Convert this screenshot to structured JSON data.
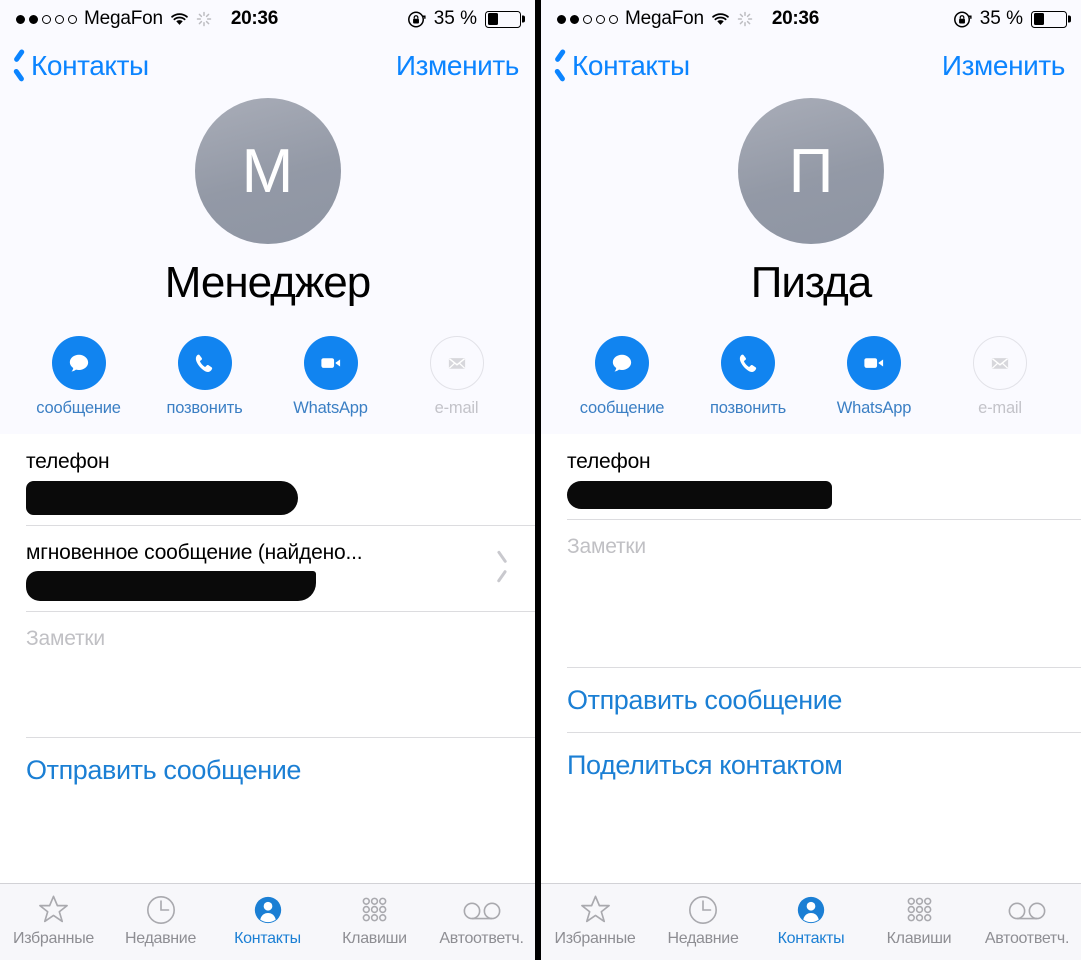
{
  "status_bar": {
    "signal_dots_filled": 2,
    "signal_dots_total": 5,
    "carrier": "MegaFon",
    "wifi_icon": "wifi-icon",
    "activity_icon": "activity-spinner-icon",
    "time": "20:36",
    "orientation_lock_icon": "rotation-lock-icon",
    "battery_percent": "35 %",
    "battery_level": 35
  },
  "nav": {
    "back_label": "Контакты",
    "back_icon": "chevron-left-icon",
    "edit_label": "Изменить"
  },
  "quick_actions": [
    {
      "label": "сообщение",
      "icon": "message-bubble-icon",
      "enabled": true
    },
    {
      "label": "позвонить",
      "icon": "phone-handset-icon",
      "enabled": true
    },
    {
      "label": "WhatsApp",
      "icon": "video-camera-icon",
      "enabled": true
    },
    {
      "label": "e-mail",
      "icon": "envelope-icon",
      "enabled": false
    }
  ],
  "panels": [
    {
      "avatar_initial": "М",
      "contact_name": "Менеджер",
      "rows": [
        {
          "label": "телефон",
          "value_redacted": true,
          "redact_class": "r1",
          "chevron": false
        },
        {
          "label": "мгновенное сообщение (найдено...",
          "value_redacted": true,
          "redact_class": "r2",
          "chevron": true
        }
      ],
      "notes_placeholder": "Заметки",
      "links": [
        {
          "label": "Отправить сообщение"
        }
      ]
    },
    {
      "avatar_initial": "П",
      "contact_name": "Пизда",
      "rows": [
        {
          "label": "телефон",
          "value_redacted": true,
          "redact_class": "r3",
          "chevron": false
        }
      ],
      "notes_placeholder": "Заметки",
      "links": [
        {
          "label": "Отправить сообщение"
        },
        {
          "label": "Поделиться контактом"
        }
      ]
    }
  ],
  "tabbar": {
    "items": [
      {
        "label": "Избранные",
        "icon": "star-icon",
        "active": false
      },
      {
        "label": "Недавние",
        "icon": "clock-icon",
        "active": false
      },
      {
        "label": "Контакты",
        "icon": "contact-person-icon",
        "active": true
      },
      {
        "label": "Клавиши",
        "icon": "keypad-icon",
        "active": false
      },
      {
        "label": "Автоответч.",
        "icon": "voicemail-icon",
        "active": false
      }
    ]
  },
  "colors": {
    "accent_blue": "#0b84ff",
    "action_blue": "#1184f0",
    "link_blue": "#1b7fd4",
    "avatar_gray": "#9399a6",
    "header_bg": "#fafaff",
    "placeholder_gray": "#c0c0c4"
  }
}
